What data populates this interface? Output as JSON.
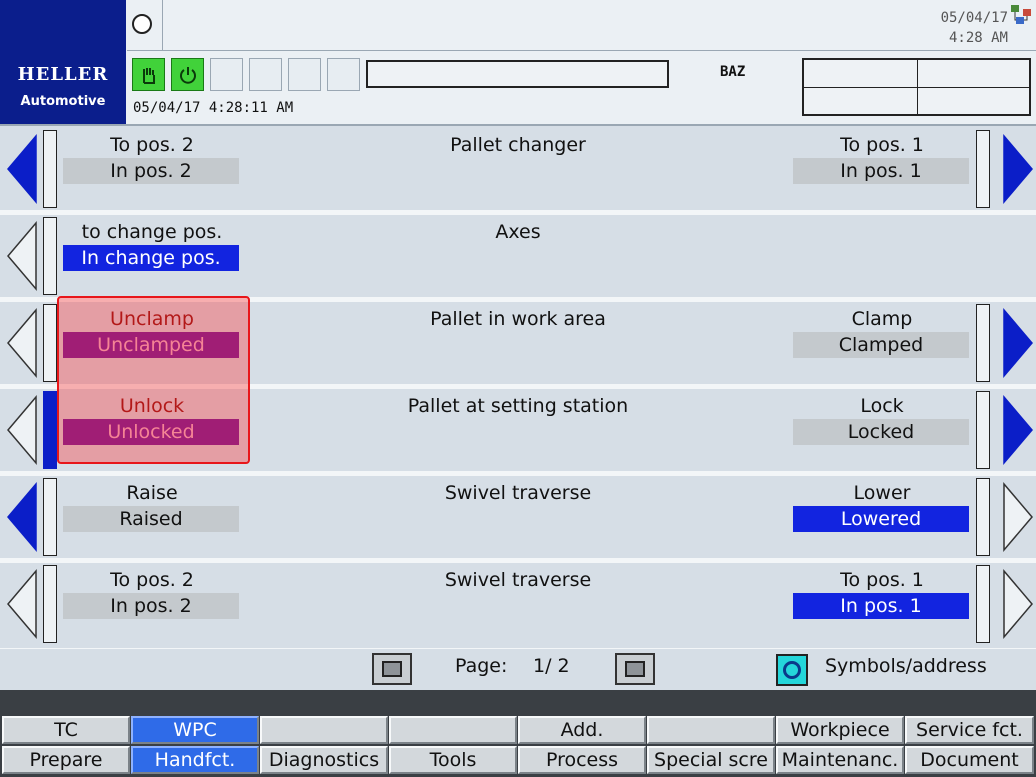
{
  "header": {
    "brand": "HELLER",
    "subbrand": "Automotive",
    "datetime": "05/04/17 4:28:11 AM",
    "channel": "BAZ",
    "clock_date": "05/04/17",
    "clock_time": "4:28 AM",
    "status_icons": [
      "hand-icon",
      "power-icon"
    ],
    "status_color": "#41d23a"
  },
  "rows": [
    {
      "title": "Pallet changer",
      "left_cmd": "To pos. 2",
      "left_status": "In pos. 2",
      "right_cmd": "To pos. 1",
      "right_status": "In pos. 1"
    },
    {
      "title": "Axes",
      "left_cmd": "to change pos.",
      "left_status": "In change pos.",
      "right_cmd": "",
      "right_status": ""
    },
    {
      "title": "Pallet in work area",
      "left_cmd": "Unclamp",
      "left_status": "Unclamped",
      "right_cmd": "Clamp",
      "right_status": "Clamped"
    },
    {
      "title": "Pallet at setting station",
      "left_cmd": "Unlock",
      "left_status": "Unlocked",
      "right_cmd": "Lock",
      "right_status": "Locked"
    },
    {
      "title": "Swivel traverse",
      "left_cmd": "Raise",
      "left_status": "Raised",
      "right_cmd": "Lower",
      "right_status": "Lowered"
    },
    {
      "title": "Swivel traverse",
      "left_cmd": "To pos. 2",
      "left_status": "In pos. 2",
      "right_cmd": "To pos. 1",
      "right_status": "In pos. 1"
    }
  ],
  "pager": {
    "label": "Page:",
    "value": "1/ 2",
    "symbols_label": "Symbols/address"
  },
  "softkeys_top": [
    "TC",
    "WPC",
    "",
    "",
    "Add. function",
    "",
    "Workpiece",
    "Service fct."
  ],
  "softkeys_bottom": [
    "Prepare",
    "Handfct.",
    "Diagnostics",
    "Tools",
    "Process",
    "Special scre",
    "Maintenanc.",
    "Document"
  ],
  "colors": {
    "active_blue": "#1224e0",
    "active_purple": "#6d1a9e",
    "selected_softkey": "#2f6be8",
    "highlight": "#e8161a",
    "arrow_blue": "#0b1ec8"
  }
}
